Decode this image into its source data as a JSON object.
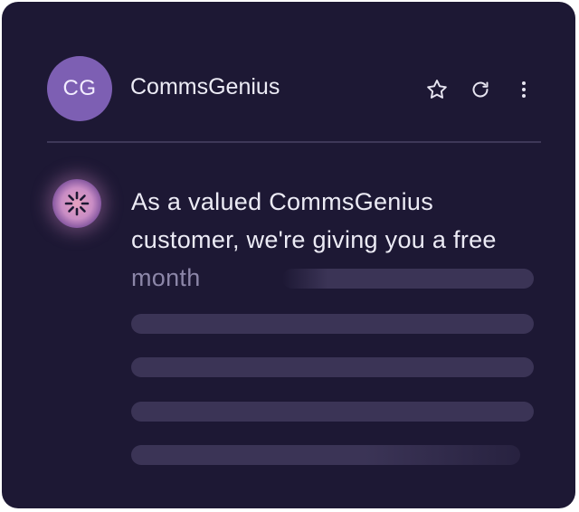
{
  "sender": {
    "avatar_initials": "CG",
    "name": "CommsGenius",
    "avatar_color": "#7d5fb3"
  },
  "actions": [
    {
      "name": "star",
      "icon": "star-icon"
    },
    {
      "name": "refresh",
      "icon": "refresh-icon"
    },
    {
      "name": "more",
      "icon": "more-vertical-icon"
    }
  ],
  "ai_indicator": {
    "icon": "loading-spinner-icon"
  },
  "message": {
    "text": "As a valued CommsGenius customer, we're giving you a free",
    "fading_text": "month"
  },
  "colors": {
    "card_background": "#1d1834",
    "skeleton": "#3b3456",
    "text": "#ecebf5"
  }
}
